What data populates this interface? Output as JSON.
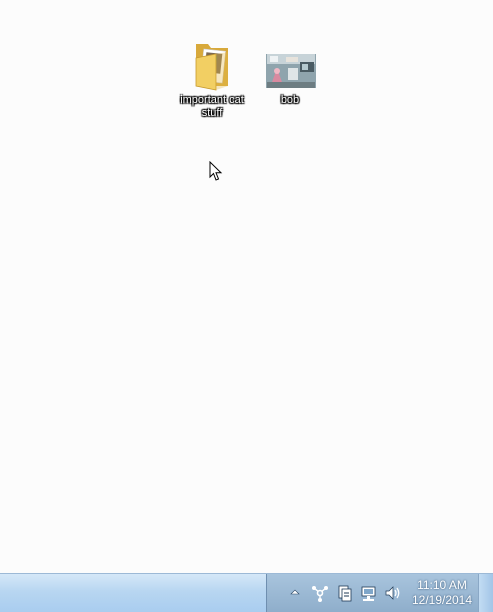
{
  "desktop": {
    "icons": [
      {
        "label": "important cat stuff",
        "type": "folder-icon"
      },
      {
        "label": "bob",
        "type": "image-thumbnail-icon"
      }
    ]
  },
  "taskbar": {
    "tray": {
      "icons": [
        "show-hidden-icons-arrow",
        "network-sharing-icon",
        "sync-center-icon",
        "network-icon",
        "volume-icon"
      ],
      "clock": {
        "time": "11:10 AM",
        "date": "12/19/2014"
      }
    }
  }
}
